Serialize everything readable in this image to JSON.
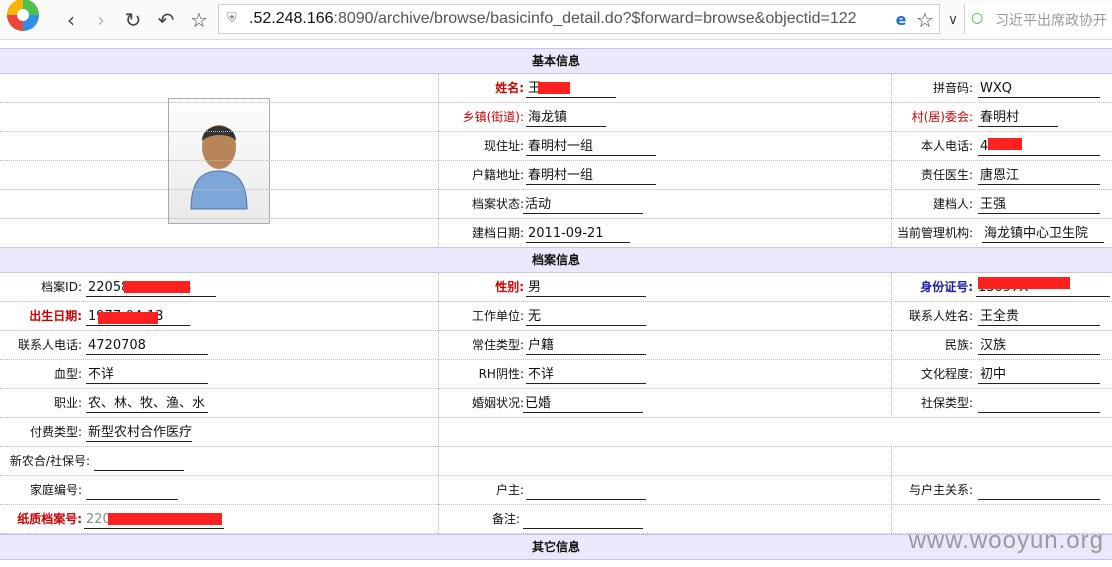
{
  "browser": {
    "url_host": ".52.248.166",
    "url_rest": ":8090/archive/browse/basicinfo_detail.do?$forward=browse&objectid=122",
    "search_placeholder": "习近平出席政协开"
  },
  "sections": {
    "basic": "基本信息",
    "archive": "档案信息",
    "other": "其它信息"
  },
  "basic": {
    "name_label": "姓名:",
    "name_value": "王",
    "pinyin_label": "拼音码:",
    "pinyin_value": "WXQ",
    "town_label": "乡镇(街道):",
    "town_value": "海龙镇",
    "village_label": "村(居)委会:",
    "village_value": "春明村",
    "address_label": "现住址:",
    "address_value": "春明村一组",
    "phone_label": "本人电话:",
    "phone_value": "4      08",
    "huji_label": "户籍地址:",
    "huji_value": "春明村一组",
    "doctor_label": "责任医生:",
    "doctor_value": "唐恩江",
    "status_label": "档案状态:",
    "status_value": "活动",
    "creator_label": "建档人:",
    "creator_value": "王强",
    "date_label": "建档日期:",
    "date_value": "2011-09-21",
    "org_label": "当前管理机构:",
    "org_value": "海龙镇中心卫生院"
  },
  "archive": {
    "id_label": "档案ID:",
    "id_value": "22058100            0478",
    "gender_label": "性别:",
    "gender_value": "男",
    "idcard_label": "身份证号:",
    "idcard_value": "                      13097X",
    "birth_label": "出生日期:",
    "birth_value": "1977-04-13",
    "work_label": "工作单位:",
    "work_value": "无",
    "contact_label": "联系人姓名:",
    "contact_value": "王全贵",
    "contact_phone_label": "联系人电话:",
    "contact_phone_value": "4720708",
    "residence_label": "常住类型:",
    "residence_value": "户籍",
    "ethnic_label": "民族:",
    "ethnic_value": "汉族",
    "blood_label": "血型:",
    "blood_value": "不详",
    "rh_label": "RH阴性:",
    "rh_value": "不详",
    "edu_label": "文化程度:",
    "edu_value": "初中",
    "job_label": "职业:",
    "job_value": "农、林、牧、渔、水",
    "marriage_label": "婚姻状况:",
    "marriage_value": "已婚",
    "social_label": "社保类型:",
    "social_value": "",
    "pay_label": "付费类型:",
    "pay_value": "新型农村合作医疗",
    "ncms_label": "新农合/社保号:",
    "ncms_value": "",
    "family_label": "家庭编号:",
    "family_value": "",
    "householder_label": "户主:",
    "householder_value": "",
    "relation_label": "与户主关系:",
    "relation_value": "",
    "paper_label": "纸质档案号:",
    "paper_value": "2205            0007",
    "remark_label": "备注:",
    "remark_value": ""
  },
  "watermark": "www.wooyun.org"
}
